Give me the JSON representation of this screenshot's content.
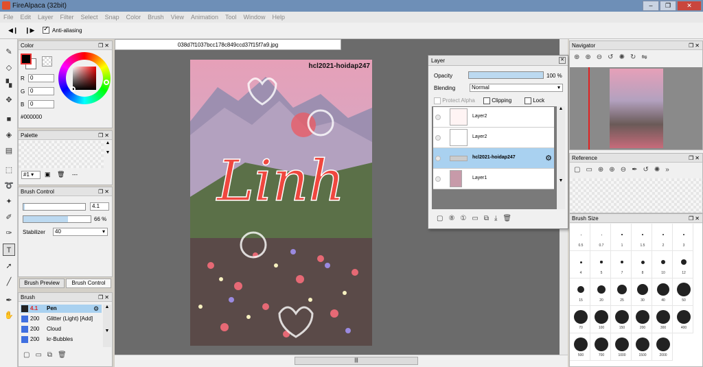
{
  "window": {
    "title": "FireAlpaca (32bit)"
  },
  "menu": [
    "File",
    "Edit",
    "Layer",
    "Filter",
    "Select",
    "Snap",
    "Color",
    "Brush",
    "View",
    "Animation",
    "Tool",
    "Window",
    "Help"
  ],
  "tool_options": {
    "antialias_label": "Anti-aliasing",
    "antialias_checked": true
  },
  "color_panel": {
    "title": "Color",
    "r_label": "R",
    "g_label": "G",
    "b_label": "B",
    "r": "0",
    "g": "0",
    "b": "0",
    "hex": "#000000"
  },
  "palette_panel": {
    "title": "Palette",
    "selector": "#1",
    "dash": "---"
  },
  "brush_control": {
    "title": "Brush Control",
    "size": "4.1",
    "opacity": "66 %",
    "opacity_fraction": 0.66,
    "stabilizer_label": "Stabilizer",
    "stabilizer": "40",
    "size_fraction": 0.02
  },
  "tabs": {
    "preview": "Brush Preview",
    "control": "Brush Control"
  },
  "brush_panel": {
    "title": "Brush",
    "items": [
      {
        "size": "4.1",
        "name": "Pen",
        "color": "#222222"
      },
      {
        "size": "200",
        "name": "Glitter (Light) [Add]",
        "color": "#3f6fe0"
      },
      {
        "size": "200",
        "name": "Cloud",
        "color": "#3f6fe0"
      },
      {
        "size": "200",
        "name": "kr-Bubbles",
        "color": "#3f6fe0"
      }
    ]
  },
  "document": {
    "tab": "038d7f1037bcc178c849ccd37f15f7a9.jpg",
    "watermark": "hcl2021-hoidap247",
    "art_word": "Linh"
  },
  "layer_panel": {
    "title": "Layer",
    "opacity_label": "Opacity",
    "opacity": "100 %",
    "blending_label": "Blending",
    "blending": "Normal",
    "protect_alpha": "Protect Alpha",
    "clipping": "Clipping",
    "lock": "Lock",
    "layers": [
      {
        "name": "Layer2",
        "selected": false
      },
      {
        "name": "Layer2",
        "selected": false
      },
      {
        "name": "hcl2021-hoidap247",
        "selected": true
      },
      {
        "name": "Layer1",
        "selected": false
      }
    ]
  },
  "navigator": {
    "title": "Navigator"
  },
  "reference": {
    "title": "Reference"
  },
  "brush_size": {
    "title": "Brush Size",
    "sizes": [
      "0.5",
      "0.7",
      "1",
      "1.5",
      "2",
      "3",
      "4",
      "5",
      "7",
      "8",
      "10",
      "12",
      "15",
      "20",
      "25",
      "30",
      "40",
      "50",
      "70",
      "100",
      "150",
      "200",
      "300",
      "400",
      "500",
      "700",
      "1000",
      "1500",
      "2000"
    ]
  },
  "colors": {
    "accent": "#a9d1f0",
    "title_bar": "#6e8fb7"
  }
}
